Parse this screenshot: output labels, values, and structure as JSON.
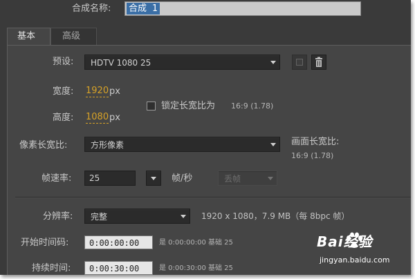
{
  "comp_name": {
    "label": "合成名称:",
    "value": "合成 1"
  },
  "tabs": [
    {
      "label": "基本"
    },
    {
      "label": "高级"
    }
  ],
  "preset": {
    "label": "预设:",
    "value": "HDTV 1080 25"
  },
  "width": {
    "label": "宽度:",
    "value": "1920",
    "unit": "px"
  },
  "height": {
    "label": "高度:",
    "value": "1080",
    "unit": "px"
  },
  "lock_aspect": {
    "label": "锁定长宽比为",
    "ratio": "16:9 (1.78)",
    "checked": false
  },
  "pixel_aspect": {
    "label": "像素长宽比:",
    "value": "方形像素"
  },
  "frame_aspect": {
    "label": "画面长宽比:",
    "value": "16:9 (1.78)"
  },
  "frame_rate": {
    "label": "帧速率:",
    "value": "25",
    "unit": "帧/秒",
    "drop_frame": "丢帧"
  },
  "resolution": {
    "label": "分辨率:",
    "value": "完整",
    "info": "1920 x 1080，7.9 MB（每 8bpc 帧）"
  },
  "start_timecode": {
    "label": "开始时间码:",
    "value": "0:00:00:00",
    "note": "是 0:00:00:00  基础 25"
  },
  "duration": {
    "label": "持续时间:",
    "value": "0:00:30:00",
    "note": "是 0:00:30:00  基础 25"
  },
  "watermark": {
    "brand": "Bai经验",
    "url": "jingyan.baidu.com"
  },
  "colors": {
    "panel": "#3a3a3a",
    "accent": "#d7a227",
    "selection": "#3a6ea5"
  }
}
